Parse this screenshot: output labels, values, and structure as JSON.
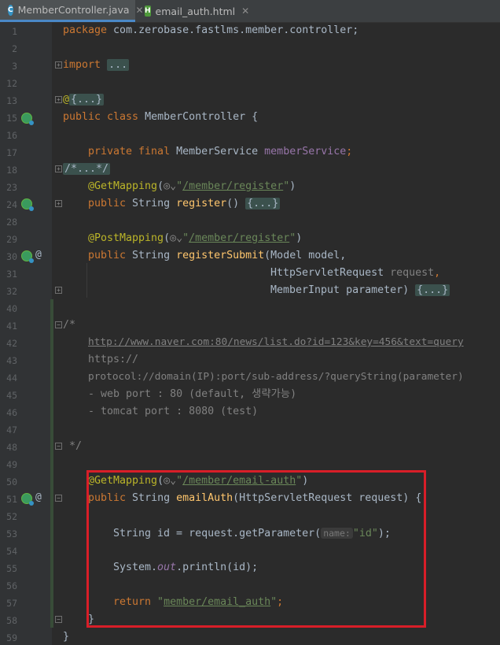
{
  "tabs": [
    {
      "label": "MemberController.java",
      "icon": "java-class-icon",
      "active": true
    },
    {
      "label": "email_auth.html",
      "icon": "html-file-icon",
      "active": false
    }
  ],
  "line_numbers": [
    "1",
    "2",
    "3",
    "12",
    "13",
    "15",
    "16",
    "17",
    "18",
    "23",
    "24",
    "28",
    "29",
    "30",
    "31",
    "32",
    "40",
    "41",
    "42",
    "43",
    "44",
    "45",
    "46",
    "47",
    "48",
    "49",
    "50",
    "51",
    "52",
    "53",
    "54",
    "55",
    "56",
    "57",
    "58",
    "59"
  ],
  "code": {
    "l1_package": "package",
    "l1_path": " com.zerobase.fastlms.member.controller;",
    "l3_import": "import",
    "l3_fold": "...",
    "l13_at": "@",
    "l13_fold": "{...}",
    "l15_public": "public class",
    "l15_name": " MemberController {",
    "l17_mod": "private final",
    "l17_type": " MemberService ",
    "l17_field": "memberService",
    "l17_semi": ";",
    "l18_comment": "/*...*/",
    "l23_ann": "@GetMapping",
    "l23_path": "/member/register",
    "l24_public": "public",
    "l24_type": " String ",
    "l24_fn": "register",
    "l24_rest": "() ",
    "l24_fold": "{...}",
    "l29_ann": "@PostMapping",
    "l29_path": "/member/register",
    "l30_public": "public",
    "l30_type": " String ",
    "l30_fn": "registerSubmit",
    "l30_rest": "(Model model,",
    "l31_type": "HttpServletRequest ",
    "l31_param": "request",
    "l31_comma": ",",
    "l32_type": "MemberInput parameter) ",
    "l32_fold": "{...}",
    "l41_comment": "/*",
    "l42_url": "http://www.naver.com:80/news/list.do?id=123&key=456&text=query",
    "l43_text": "https://",
    "l44_text": "protocol://domain(IP):port/sub-address/?queryString(parameter)",
    "l45_text": "- web port : 80 (default, 생략가능)",
    "l46_text": "- tomcat port : 8080 (test)",
    "l48_comment": " */",
    "l50_ann": "@GetMapping",
    "l50_path": "/member/email-auth",
    "l51_public": "public",
    "l51_type": " String ",
    "l51_fn": "emailAuth",
    "l51_rest": "(HttpServletRequest request) {",
    "l53_a": "String id = request.getParameter(",
    "l53_hint": "name:",
    "l53_str": "\"id\"",
    "l53_end": ");",
    "l55_a": "System.",
    "l55_out": "out",
    "l55_b": ".println(id);",
    "l57_return": "return ",
    "l57_path": "member/email_auth",
    "l57_semi": ";",
    "l58_brace": "}",
    "l59_brace": "}"
  },
  "colors": {
    "background": "#2b2b2b",
    "keyword": "#cc7832",
    "annotation": "#bbb529",
    "string": "#6a8759",
    "highlight_box": "#d81e28"
  }
}
